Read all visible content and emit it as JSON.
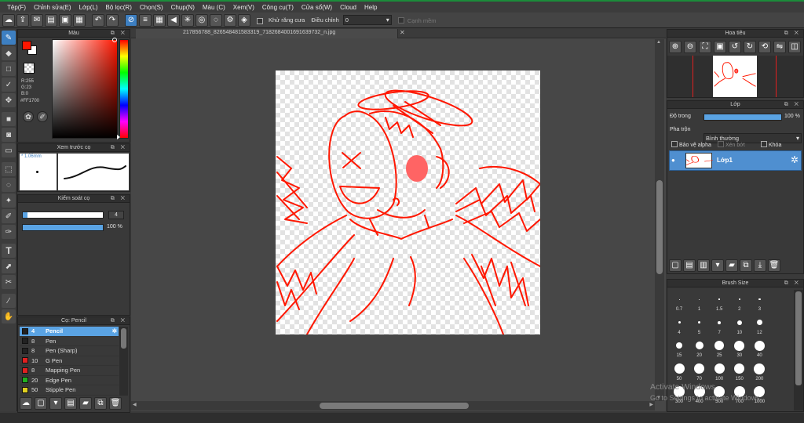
{
  "menu": [
    "Tệp(F)",
    "Chỉnh sửa(E)",
    "Lớp(L)",
    "Bộ lọc(R)",
    "Chọn(S)",
    "Chụp(N)",
    "Màu (C)",
    "Xem(V)",
    "Công cụ(T)",
    "Cửa sổ(W)",
    "Cloud",
    "Help"
  ],
  "toolbar": {
    "antialias_label": "Khử răng cưa",
    "adjust_label": "Điều chỉnh",
    "adjust_value": "0",
    "snap_label": "Cạnh mềm"
  },
  "color_panel": {
    "title": "Màu",
    "r": "R:255",
    "g": "G:23",
    "b": "B:0",
    "hex": "#FF1700",
    "primary_color": "#ff1700",
    "secondary_color": "#ffffff"
  },
  "brush_preview": {
    "title": "Xem trước cọ",
    "size": "1.06mm"
  },
  "brush_control": {
    "title": "Kiểm soát cọ",
    "size_value": "4",
    "opacity_value": "100 %",
    "opacity_fraction": 1.0
  },
  "brush_list": {
    "title": "Cọ: Pencil",
    "items": [
      {
        "num": "4",
        "name": "Pencil",
        "color": "#222222"
      },
      {
        "num": "8",
        "name": "Pen",
        "color": "#222222"
      },
      {
        "num": "8",
        "name": "Pen (Sharp)",
        "color": "#222222"
      },
      {
        "num": "10",
        "name": "G Pen",
        "color": "#e02020"
      },
      {
        "num": "8",
        "name": "Mapping Pen",
        "color": "#e02020"
      },
      {
        "num": "20",
        "name": "Edge Pen",
        "color": "#20b020"
      },
      {
        "num": "50",
        "name": "Stipple Pen",
        "color": "#e0d020"
      }
    ]
  },
  "document": {
    "tab_title": "217856788_826548481583319_7182684001691639732_n.jpg"
  },
  "navigator": {
    "title": "Hoa tiêu"
  },
  "layer_panel": {
    "title": "Lớp",
    "opacity_label": "Độ trong",
    "opacity_value": "100 %",
    "opacity_fraction": 1.0,
    "blend_label": "Pha trộn",
    "blend_value": "Bình thường",
    "protect_alpha": "Bảo vệ alpha",
    "clipping": "Xén bớt",
    "lock": "Khóa",
    "layers": [
      {
        "name": "Lớp1"
      }
    ]
  },
  "brush_size": {
    "title": "Brush Size",
    "sizes": [
      "0.7",
      "1",
      "1.5",
      "2",
      "3",
      "4",
      "5",
      "7",
      "10",
      "12",
      "15",
      "20",
      "25",
      "30",
      "40",
      "50",
      "70",
      "100",
      "150",
      "200",
      "300",
      "400",
      "500",
      "700",
      "1000"
    ]
  },
  "watermark": {
    "line1": "Activate Windows",
    "line2": "Go to Settings to activate Windows."
  },
  "colors": {
    "accent": "#3d7fc1",
    "selected_row": "#5aa3e3",
    "drawing_stroke": "#ff1700"
  }
}
